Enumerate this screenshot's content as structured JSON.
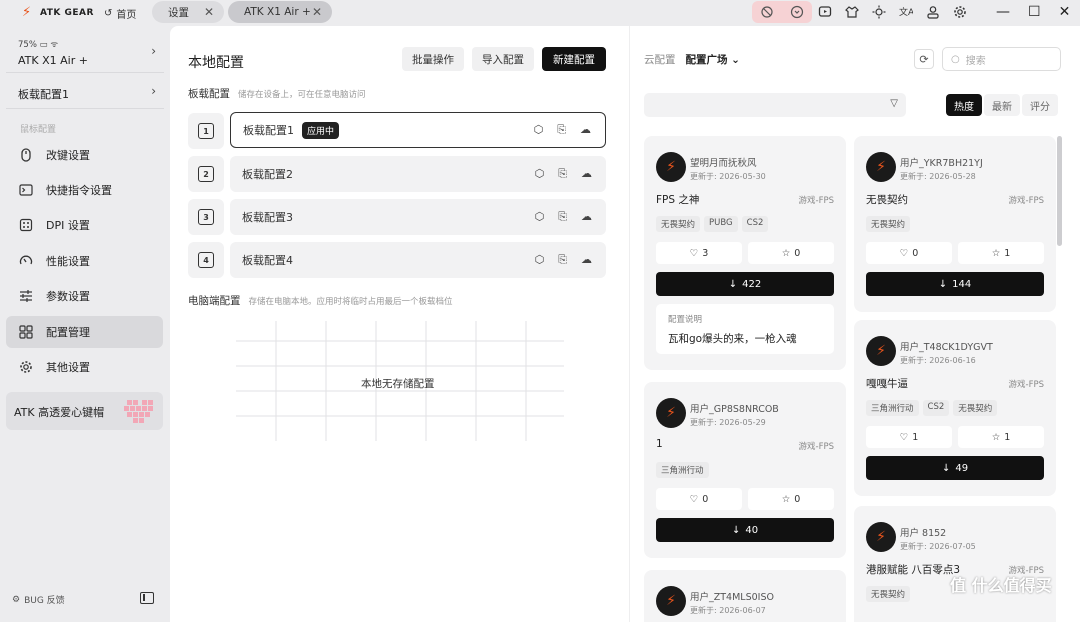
{
  "titlebar": {
    "brand": "ATK GEAR",
    "home_label": "首页",
    "tabs": [
      {
        "label": "设置"
      },
      {
        "label": "ATK X1 Air +"
      }
    ],
    "icons": [
      "block-icon",
      "shield-icon",
      "gamepad-icon",
      "shirt-icon",
      "sun-icon",
      "translate-icon",
      "user-icon",
      "gear-icon"
    ],
    "window": [
      "minimize",
      "maximize",
      "close"
    ]
  },
  "sidebar": {
    "battery": "75%",
    "device_name": "ATK X1 Air +",
    "profile_name": "板载配置1",
    "section_label": "鼠标配置",
    "items": [
      {
        "label": "改键设置",
        "icon": "mouse-icon"
      },
      {
        "label": "快捷指令设置",
        "icon": "terminal-icon"
      },
      {
        "label": "DPI 设置",
        "icon": "dpi-icon"
      },
      {
        "label": "性能设置",
        "icon": "gauge-icon"
      },
      {
        "label": "参数设置",
        "icon": "sliders-icon"
      },
      {
        "label": "配置管理",
        "icon": "grid-icon"
      },
      {
        "label": "其他设置",
        "icon": "gear-icon"
      }
    ],
    "active_item": "配置管理",
    "promo_label": "ATK 高透爱心键帽",
    "feedback_label": "BUG 反馈"
  },
  "local": {
    "title": "本地配置",
    "buttons": {
      "batch": "批量操作",
      "import": "导入配置",
      "new": "新建配置"
    },
    "onboard_title": "板载配置",
    "onboard_desc": "储存在设备上，可在任意电脑访问",
    "rows": [
      {
        "num": "1",
        "label": "板载配置1",
        "badge": "应用中"
      },
      {
        "num": "2",
        "label": "板载配置2"
      },
      {
        "num": "3",
        "label": "板载配置3"
      },
      {
        "num": "4",
        "label": "板载配置4"
      }
    ],
    "pc_title": "电脑端配置",
    "pc_desc": "存储在电脑本地。应用时将临时占用最后一个板载档位",
    "empty_text": "本地无存储配置"
  },
  "cloud": {
    "tab_cloud": "云配置",
    "tab_square": "配置广场",
    "search_placeholder": "搜索",
    "sort": [
      "热度",
      "最新",
      "评分"
    ],
    "sort_active": "热度",
    "update_prefix": "更新于:",
    "note_header": "配置说明",
    "cards": [
      {
        "user": "望明月而抚秋风",
        "date": "2026-05-30",
        "title": "FPS 之神",
        "game": "游戏-FPS",
        "tags": [
          "无畏契约",
          "PUBG",
          "CS2"
        ],
        "likes": "3",
        "favs": "0",
        "downloads": "422",
        "note": "瓦和go爆头的来，一枪入魂"
      },
      {
        "user": "用户_GP8S8NRCOB",
        "date": "2026-05-29",
        "title": "1",
        "game": "游戏-FPS",
        "tags": [
          "三角洲行动"
        ],
        "likes": "0",
        "favs": "0",
        "downloads": "40"
      },
      {
        "user": "用户_ZT4MLS0ISO",
        "date": "2026-06-07"
      },
      {
        "user": "用户_YKR7BH21YJ",
        "date": "2026-05-28",
        "title": "无畏契约",
        "game": "游戏-FPS",
        "tags": [
          "无畏契约"
        ],
        "likes": "0",
        "favs": "1",
        "downloads": "144"
      },
      {
        "user": "用户_T48CK1DYGVT",
        "date": "2026-06-16",
        "title": "嘎嘎牛逼",
        "game": "游戏-FPS",
        "tags": [
          "三角洲行动",
          "CS2",
          "无畏契约"
        ],
        "likes": "1",
        "favs": "1",
        "downloads": "49"
      },
      {
        "user": "用户 8152",
        "date": "2026-07-05",
        "title": "港服赋能 八百零点3",
        "game": "游戏-FPS",
        "tags": [
          "无畏契约"
        ]
      }
    ]
  },
  "watermark": "值 什么值得买"
}
